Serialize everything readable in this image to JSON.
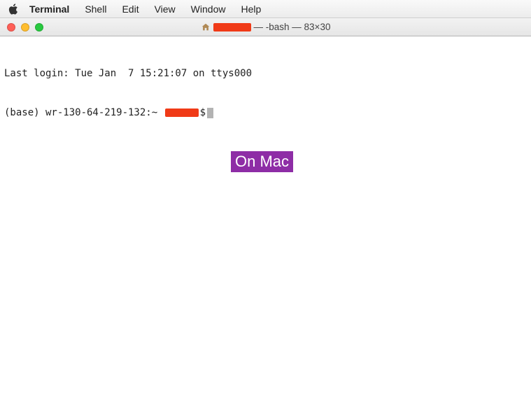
{
  "menubar": {
    "app": "Terminal",
    "items": [
      "Shell",
      "Edit",
      "View",
      "Window",
      "Help"
    ]
  },
  "titlebar": {
    "title_suffix": "— -bash — 83×30"
  },
  "terminal": {
    "last_login": "Last login: Tue Jan  7 15:21:07 on ttys000",
    "prompt_prefix": "(base) wr-130-64-219-132:~ ",
    "prompt_suffix": "$"
  },
  "overlay": {
    "label": "On Mac"
  }
}
